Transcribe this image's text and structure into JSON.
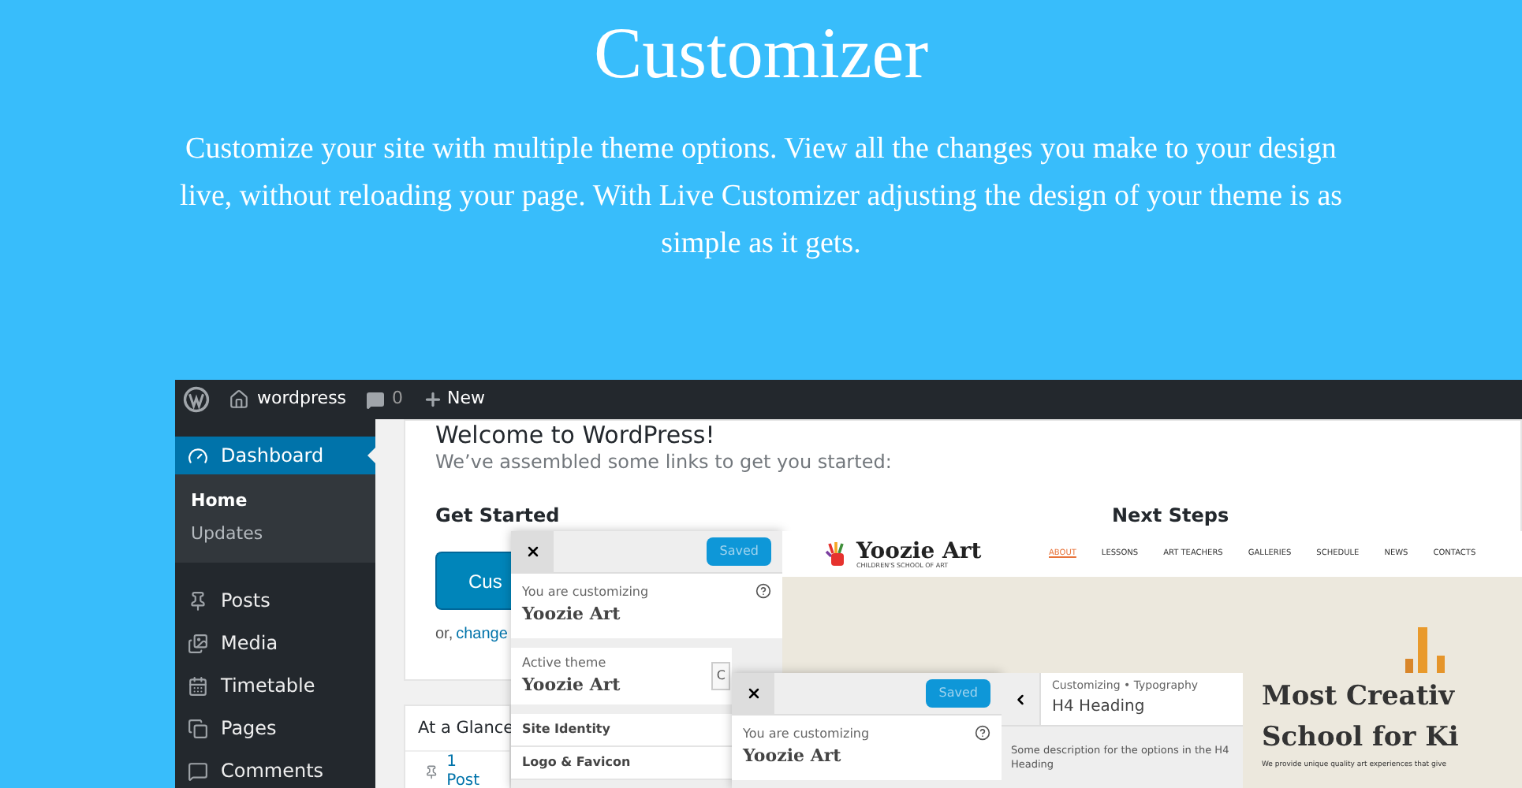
{
  "header": {
    "title": "Customizer",
    "description": "Customize your site with multiple theme options. View all the changes you make to your design live, without reloading your page. With Live Customizer adjusting the design of your theme is as simple as it gets."
  },
  "admin_bar": {
    "site": "wordpress",
    "comments": "0",
    "new": "New"
  },
  "sidebar": {
    "items": [
      {
        "label": "Dashboard",
        "selected": true,
        "children": [
          {
            "label": "Home",
            "selected": true
          },
          {
            "label": "Updates",
            "selected": false
          }
        ]
      },
      {
        "label": "Posts",
        "selected": false
      },
      {
        "label": "Media",
        "selected": false
      },
      {
        "label": "Timetable",
        "selected": false
      },
      {
        "label": "Pages",
        "selected": false
      },
      {
        "label": "Comments",
        "selected": false
      }
    ]
  },
  "dashboard": {
    "welcome_title": "Welcome to WordPress!",
    "welcome_subtitle": "We’ve assembled some links to get you started:",
    "get_started": "Get Started",
    "button": "Cus",
    "link_prefix": "or,",
    "link": "change",
    "next_steps": "Next Steps",
    "glance_title": "At a Glance",
    "glance_item": "1 Post"
  },
  "customizer_panel": {
    "saved": "Saved",
    "caption": "You are customizing",
    "theme": "Yoozie Art",
    "active_caption": "Active theme",
    "active_theme": "Yoozie Art",
    "change_button": "C",
    "sections": [
      "Site Identity",
      "Logo & Favicon"
    ]
  },
  "preview": {
    "logo": "Yoozie Art",
    "tagline": "CHILDREN'S SCHOOL OF ART",
    "nav": [
      {
        "label": "ABOUT",
        "selected": true
      },
      {
        "label": "LESSONS",
        "selected": false
      },
      {
        "label": "ART TEACHERS",
        "selected": false
      },
      {
        "label": "GALLERIES",
        "selected": false
      },
      {
        "label": "SCHEDULE",
        "selected": false
      },
      {
        "label": "NEWS",
        "selected": false
      },
      {
        "label": "CONTACTS",
        "selected": false
      }
    ]
  },
  "customizer_panel_2": {
    "saved": "Saved",
    "caption": "You are customizing",
    "theme": "Yoozie Art"
  },
  "typography_panel": {
    "breadcrumb": "Customizing • Typography",
    "title": "H4 Heading",
    "description": "Some description for the options in the H4 Heading"
  },
  "hero": {
    "title_lines": [
      "Most Creativ",
      "School for Ki"
    ],
    "text": "We provide unique quality art experiences that give"
  }
}
